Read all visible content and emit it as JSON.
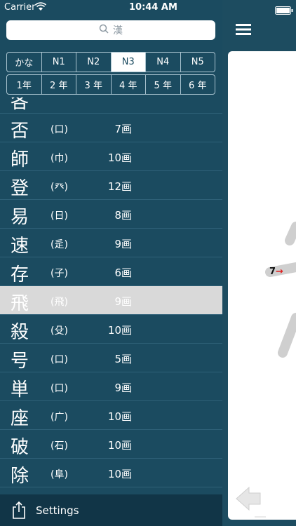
{
  "status": {
    "carrier": "Carrier",
    "time": "10:44 AM"
  },
  "search": {
    "placeholder": "漢"
  },
  "segments_level": [
    {
      "label": "かな",
      "selected": false
    },
    {
      "label": "N1",
      "selected": false
    },
    {
      "label": "N2",
      "selected": false
    },
    {
      "label": "N3",
      "selected": true
    },
    {
      "label": "N4",
      "selected": false
    },
    {
      "label": "N5",
      "selected": false
    }
  ],
  "segments_grade": [
    {
      "label": "1年"
    },
    {
      "label": "2 年"
    },
    {
      "label": "3 年"
    },
    {
      "label": "4 年"
    },
    {
      "label": "5 年"
    },
    {
      "label": "6 年"
    }
  ],
  "kanji": [
    {
      "kanji": "否",
      "radical": "(口)",
      "strokes": "7画"
    },
    {
      "kanji": "師",
      "radical": "(巾)",
      "strokes": "10画"
    },
    {
      "kanji": "登",
      "radical": "(癶)",
      "strokes": "12画"
    },
    {
      "kanji": "易",
      "radical": "(日)",
      "strokes": "8画"
    },
    {
      "kanji": "速",
      "radical": "(辵)",
      "strokes": "9画"
    },
    {
      "kanji": "存",
      "radical": "(子)",
      "strokes": "6画"
    },
    {
      "kanji": "飛",
      "radical": "(飛)",
      "strokes": "9画",
      "selected": true
    },
    {
      "kanji": "殺",
      "radical": "(殳)",
      "strokes": "10画"
    },
    {
      "kanji": "号",
      "radical": "(口)",
      "strokes": "5画"
    },
    {
      "kanji": "単",
      "radical": "(口)",
      "strokes": "9画"
    },
    {
      "kanji": "座",
      "radical": "(广)",
      "strokes": "10画"
    },
    {
      "kanji": "破",
      "radical": "(石)",
      "strokes": "10画"
    },
    {
      "kanji": "除",
      "radical": "(阜)",
      "strokes": "10画"
    }
  ],
  "bottom": {
    "settings_label": "Settings"
  },
  "stroke_label": "7→",
  "colors": {
    "panel": "#1b4b60",
    "bar": "#113547",
    "selected_row": "#d9d9d9",
    "stroke_arrow": "#e02020"
  }
}
